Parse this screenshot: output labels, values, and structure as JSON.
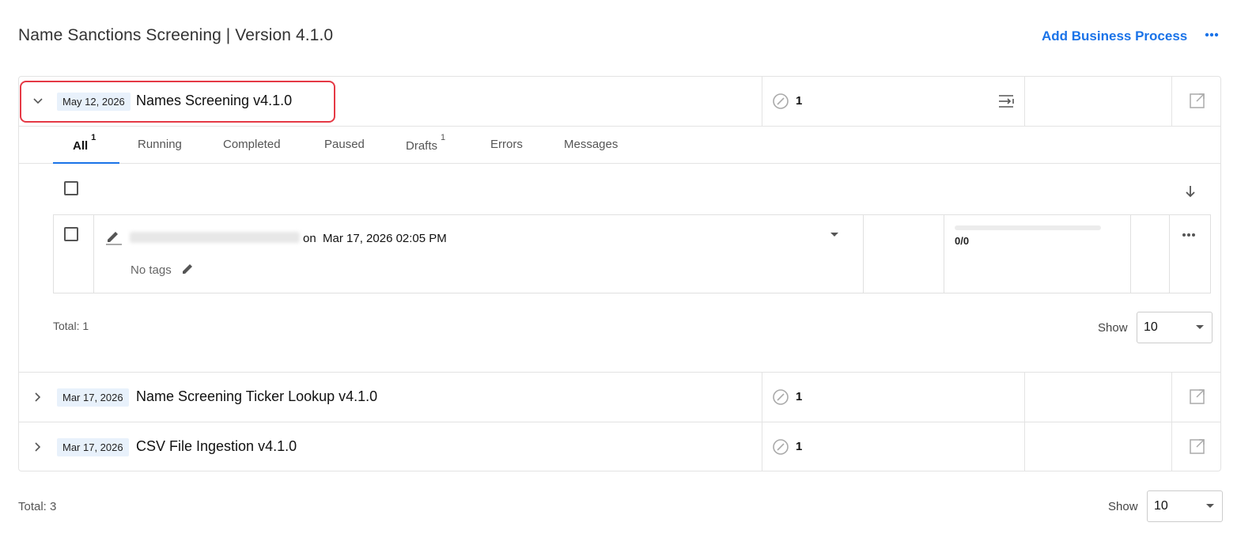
{
  "header": {
    "title": "Name Sanctions Screening | Version 4.1.0",
    "add_business_process": "Add Business Process",
    "more_icon": "more-horizontal-icon"
  },
  "processes": [
    {
      "date": "May 12, 2026",
      "title": "Names Screening v4.1.0",
      "count": "1",
      "expanded": true
    },
    {
      "date": "Mar 17, 2026",
      "title": "Name Screening Ticker Lookup v4.1.0",
      "count": "1",
      "expanded": false
    },
    {
      "date": "Mar 17, 2026",
      "title": "CSV File Ingestion v4.1.0",
      "count": "1",
      "expanded": false
    }
  ],
  "tabs": [
    {
      "label": "All",
      "badge": "1",
      "active": true
    },
    {
      "label": "Running",
      "badge": ""
    },
    {
      "label": "Completed",
      "badge": ""
    },
    {
      "label": "Paused",
      "badge": ""
    },
    {
      "label": "Drafts",
      "badge": "1"
    },
    {
      "label": "Errors",
      "badge": ""
    },
    {
      "label": "Messages",
      "badge": ""
    }
  ],
  "instance": {
    "on_text": "on  Mar 17, 2026 02:05 PM",
    "no_tags": "No tags",
    "progress": "0/0"
  },
  "inner_footer": {
    "total": "Total: 1",
    "show_label": "Show",
    "show_value": "10"
  },
  "outer_footer": {
    "total": "Total: 3",
    "show_label": "Show",
    "show_value": "10"
  },
  "colors": {
    "accent": "#1a73e8",
    "highlight": "#e53945",
    "badge_bg": "#e8f1fb"
  }
}
